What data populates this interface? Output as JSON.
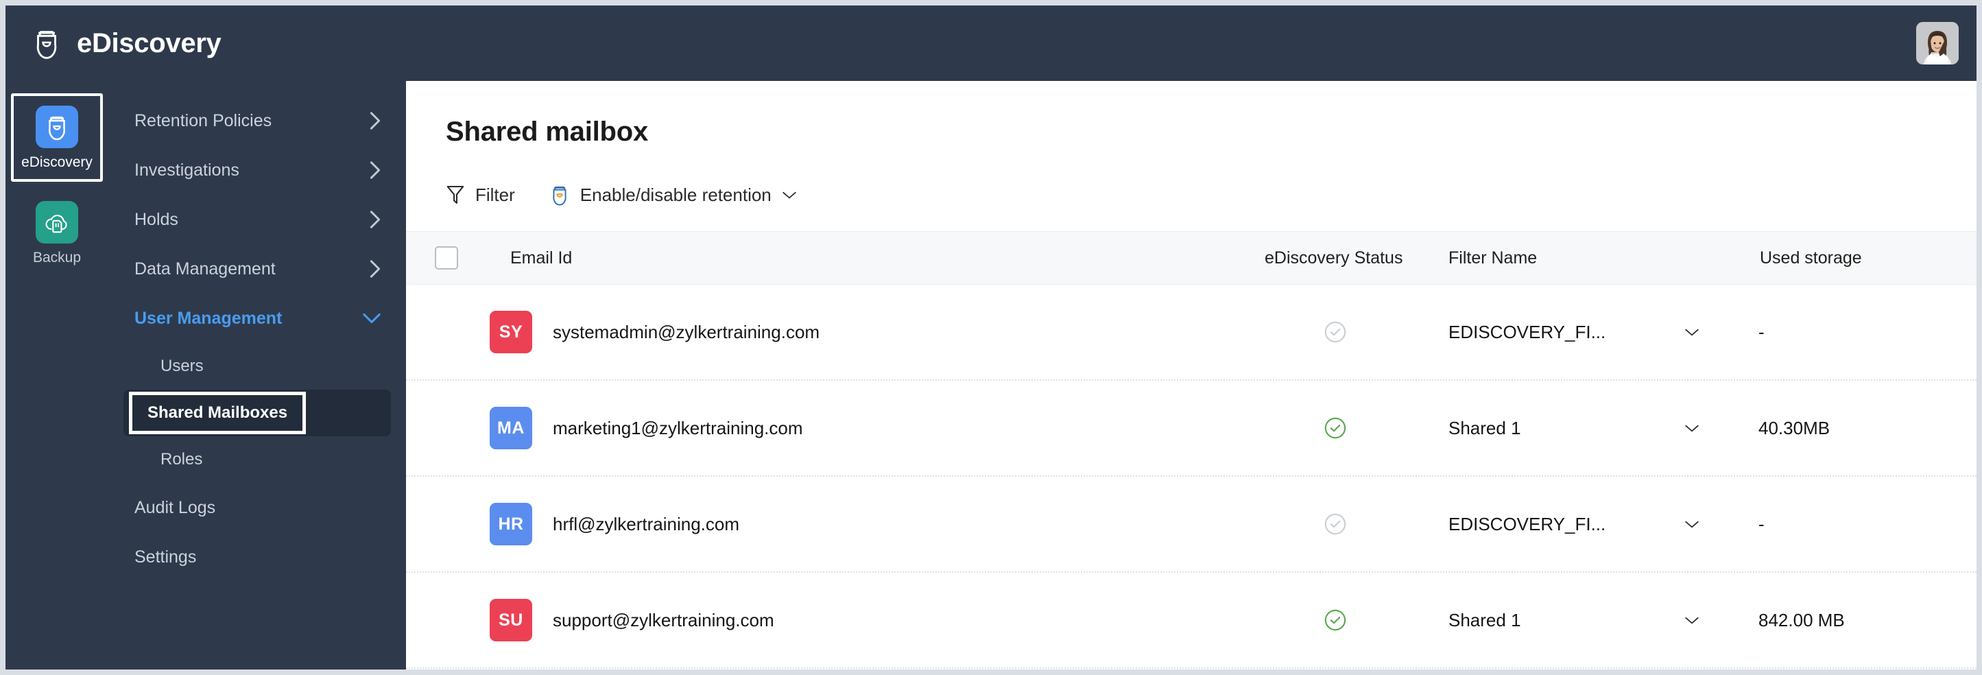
{
  "header": {
    "app_name": "eDiscovery",
    "logo_icon": "shield-helmet-icon",
    "profile_avatar": "user-photo-avatar"
  },
  "app_rail": {
    "items": [
      {
        "label": "eDiscovery",
        "icon": "shield-helmet-icon",
        "color": "#4a90f2",
        "selected": true
      },
      {
        "label": "Backup",
        "icon": "cloud-backup-icon",
        "color": "#25a08a",
        "selected": false
      }
    ]
  },
  "sidebar": {
    "items": [
      {
        "label": "Retention Policies",
        "chevron": "chevron-right-icon",
        "active": false
      },
      {
        "label": "Investigations",
        "chevron": "chevron-right-icon",
        "active": false
      },
      {
        "label": "Holds",
        "chevron": "chevron-right-icon",
        "active": false
      },
      {
        "label": "Data Management",
        "chevron": "chevron-right-icon",
        "active": false
      },
      {
        "label": "User Management",
        "chevron": "chevron-down-icon",
        "active": true
      }
    ],
    "sub_items": [
      {
        "label": "Users",
        "selected": false
      },
      {
        "label": "Shared Mailboxes",
        "selected": true
      },
      {
        "label": "Roles",
        "selected": false
      }
    ],
    "bottom_items": [
      {
        "label": "Audit Logs"
      },
      {
        "label": "Settings"
      }
    ]
  },
  "main": {
    "title": "Shared mailbox",
    "toolbar": {
      "filter_label": "Filter",
      "filter_icon": "funnel-icon",
      "retention_label": "Enable/disable retention",
      "retention_icon": "shield-retention-icon",
      "retention_chevron": "chevron-down-icon"
    },
    "table": {
      "columns": [
        "Email Id",
        "eDiscovery Status",
        "Filter Name",
        "Used storage"
      ],
      "select_all_checkbox": "unchecked",
      "rows": [
        {
          "initials": "SY",
          "avatar_color": "#ec4154",
          "email": "systemadmin@zylkertraining.com",
          "status": "disabled",
          "status_icon": "check-circle-icon",
          "filter_name": "EDISCOVERY_FI...",
          "filter_chevron": "chevron-down-icon",
          "used_storage": "-"
        },
        {
          "initials": "MA",
          "avatar_color": "#5b8def",
          "email": "marketing1@zylkertraining.com",
          "status": "enabled",
          "status_icon": "check-circle-icon",
          "filter_name": "Shared 1",
          "filter_chevron": "chevron-down-icon",
          "used_storage": "40.30MB"
        },
        {
          "initials": "HR",
          "avatar_color": "#5b8def",
          "email": "hrfl@zylkertraining.com",
          "status": "disabled",
          "status_icon": "check-circle-icon",
          "filter_name": "EDISCOVERY_FI...",
          "filter_chevron": "chevron-down-icon",
          "used_storage": "-"
        },
        {
          "initials": "SU",
          "avatar_color": "#ec4154",
          "email": "support@zylkertraining.com",
          "status": "enabled",
          "status_icon": "check-circle-icon",
          "filter_name": "Shared 1",
          "filter_chevron": "chevron-down-icon",
          "used_storage": "842.00 MB"
        }
      ]
    }
  },
  "colors": {
    "sidebar_bg": "#2e3a4c",
    "accent_blue": "#4a9cf0",
    "status_enabled": "#5aa84f",
    "status_disabled": "#c4c8cd",
    "backup_green": "#25a08a"
  }
}
